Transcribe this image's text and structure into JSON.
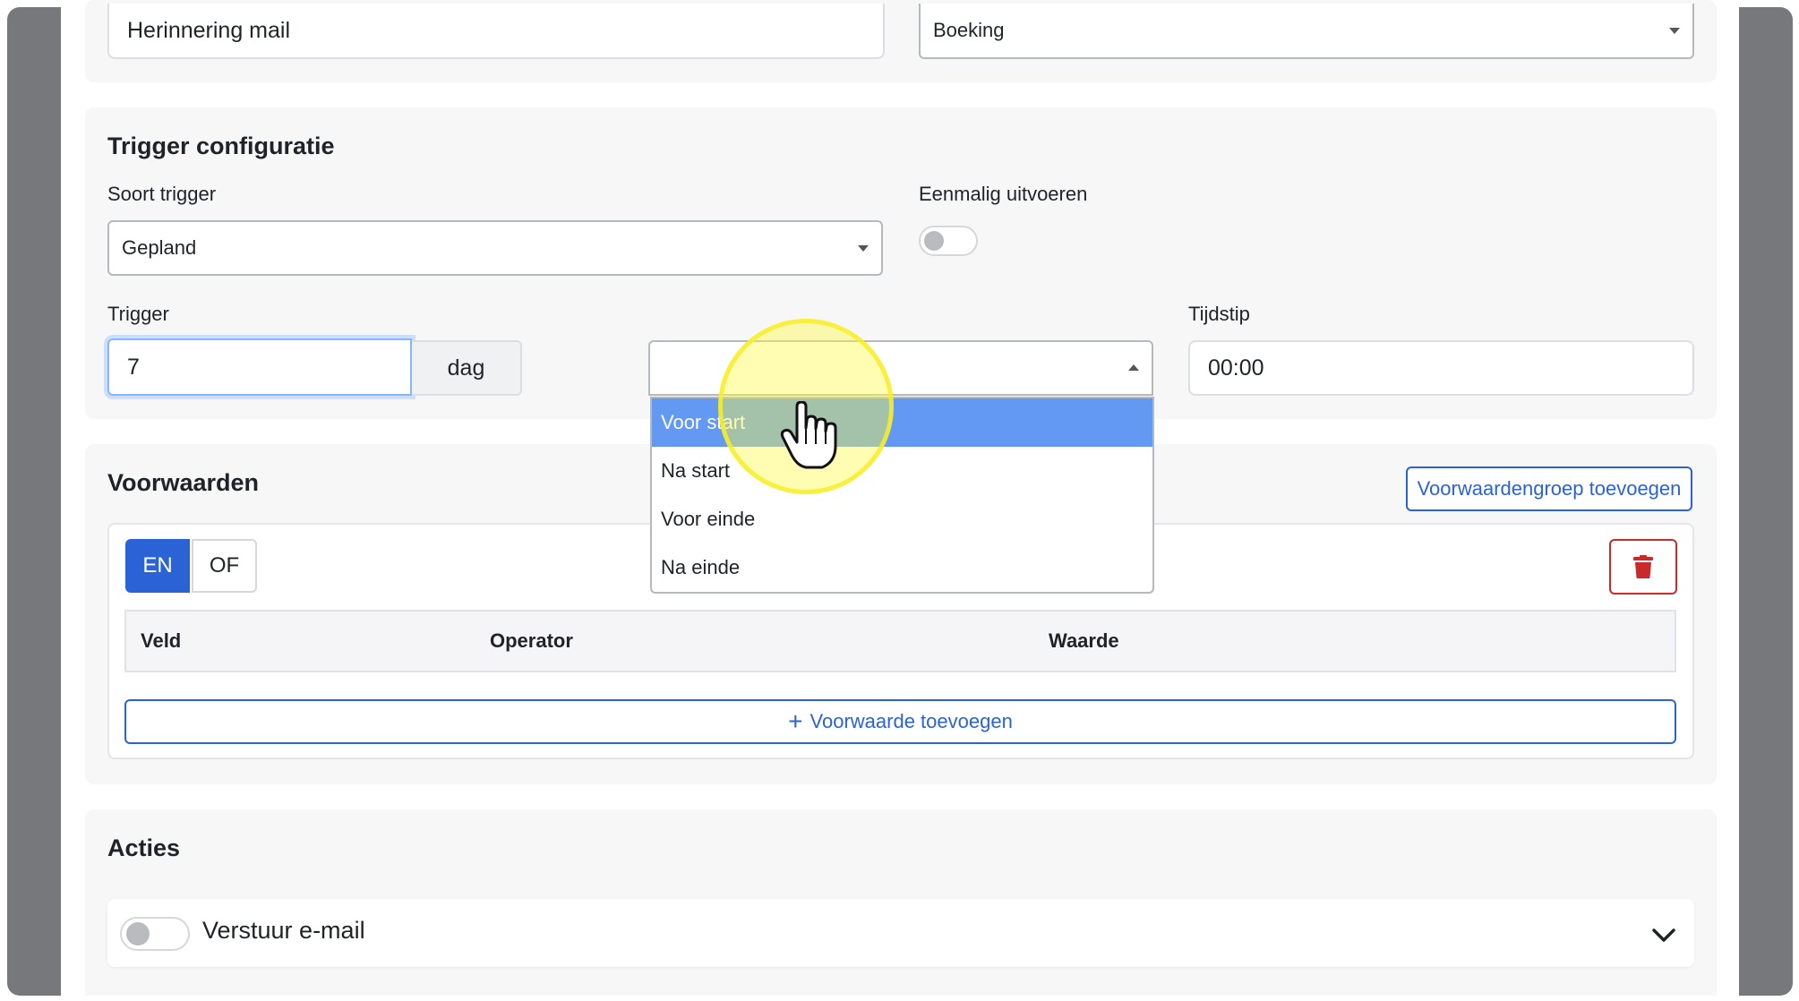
{
  "top_row": {
    "name_value": "Herinnering mail",
    "type_select": "Boeking"
  },
  "trigger_config": {
    "title": "Trigger configuratie",
    "trigger_type_label": "Soort trigger",
    "trigger_type_value": "Gepland",
    "run_once_label": "Eenmalig uitvoeren",
    "trigger_label": "Trigger",
    "trigger_amount": "7",
    "trigger_unit": "dag",
    "time_label": "Tijdstip",
    "time_value": "00:00",
    "relation_options": [
      "Voor start",
      "Na start",
      "Voor einde",
      "Na einde"
    ]
  },
  "conditions": {
    "title": "Voorwaarden",
    "add_group_label": "Voorwaardengroep toevoegen",
    "logic_and": "EN",
    "logic_or": "OF",
    "columns": [
      "Veld",
      "Operator",
      "Waarde"
    ],
    "add_condition_label": "Voorwaarde toevoegen"
  },
  "actions": {
    "title": "Acties",
    "items": [
      {
        "label": "Verstuur e-mail"
      }
    ]
  },
  "icons": {
    "trash": "trash-icon",
    "plus": "plus-icon",
    "chevron": "chevron-down-icon",
    "cursor": "hand-pointer-icon"
  },
  "colors": {
    "primary": "#2b63d6",
    "danger": "#c92a2a",
    "selected_option": "#6398f3",
    "highlight": "#fff24a"
  }
}
